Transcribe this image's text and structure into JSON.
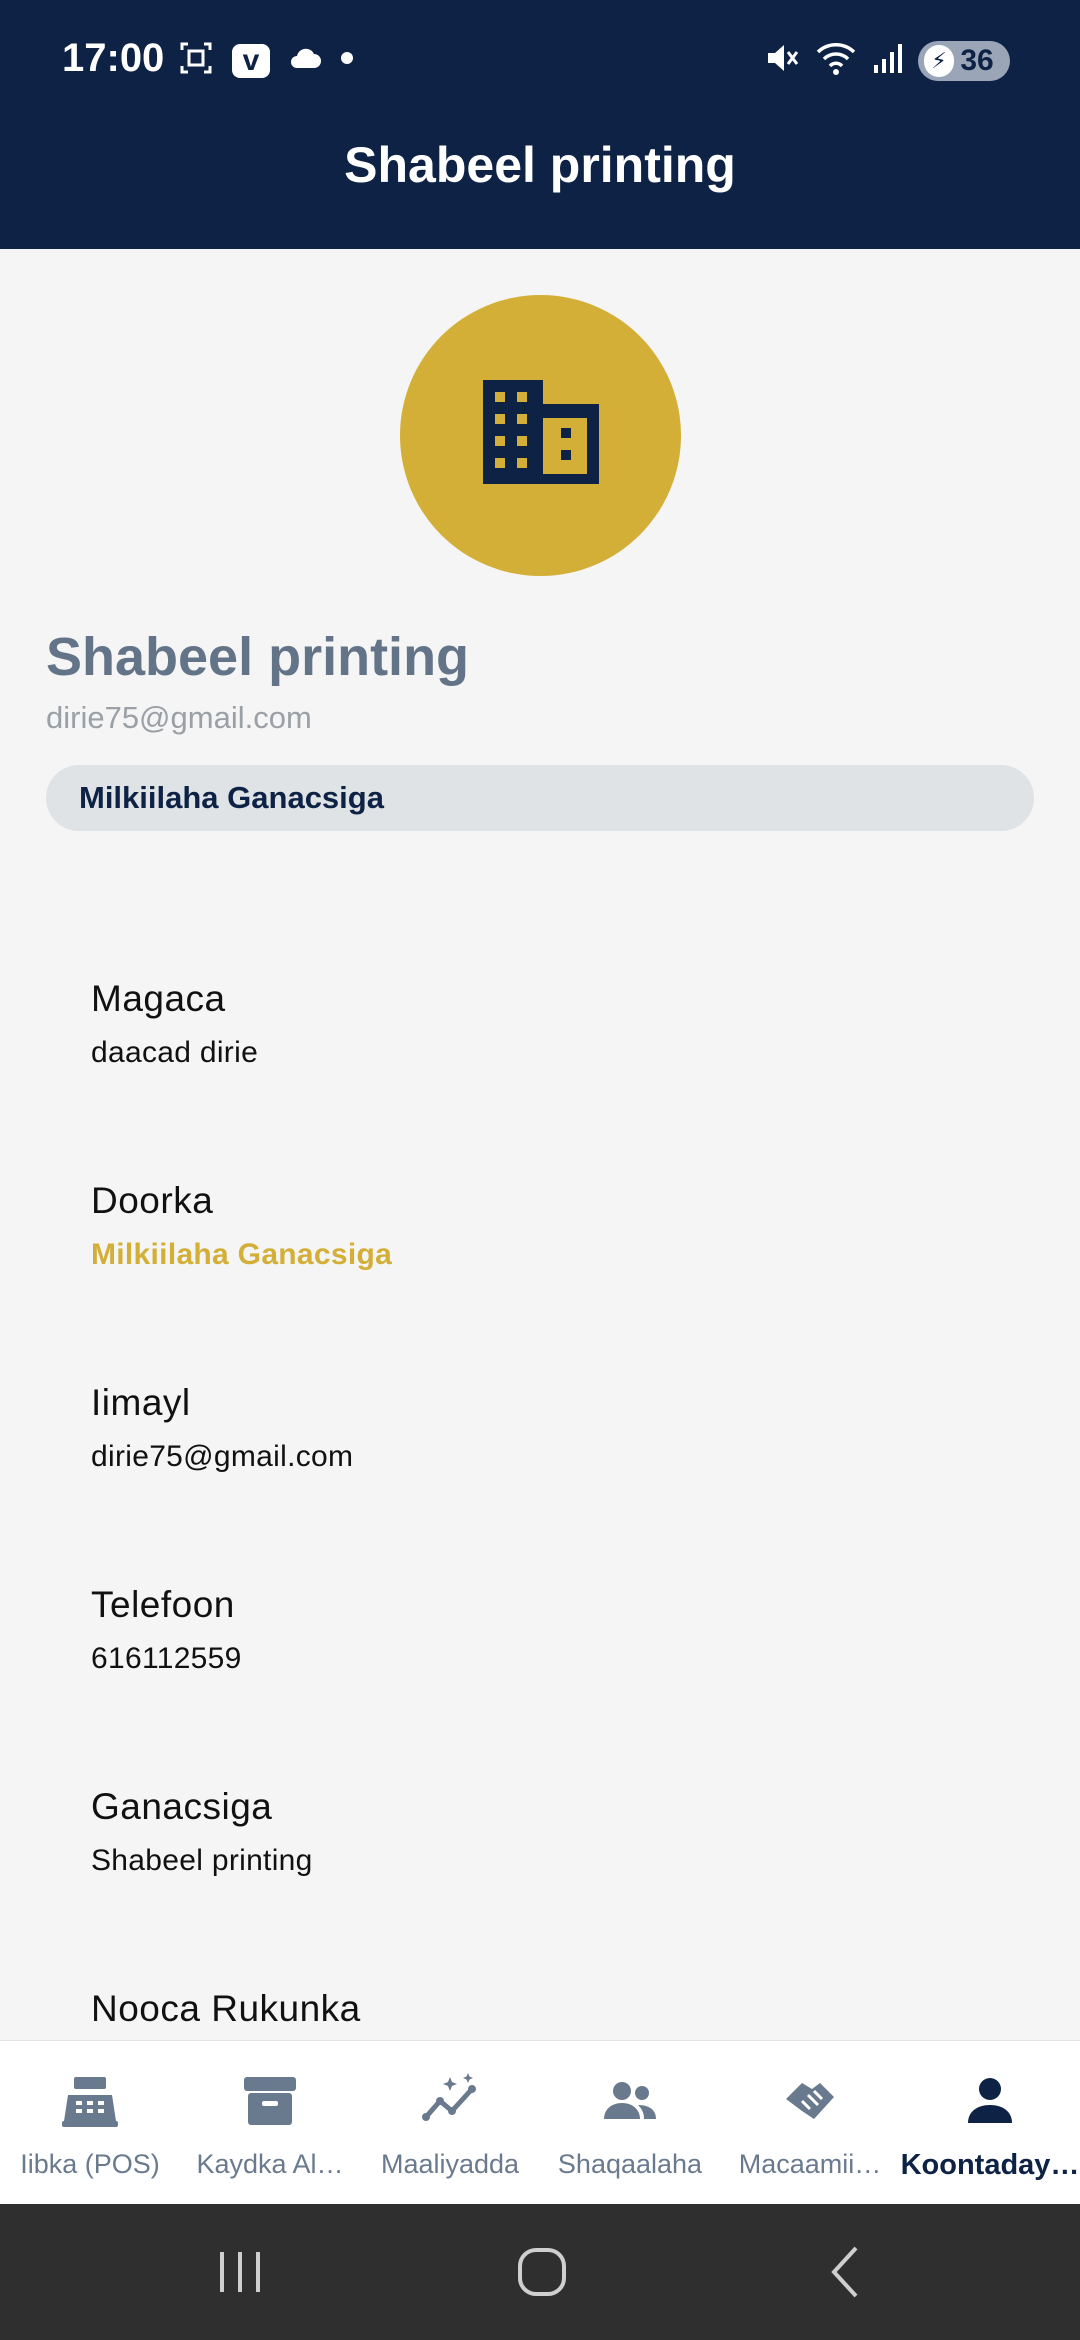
{
  "status_bar": {
    "time": "17:00",
    "battery": "36",
    "icons": [
      "screenshot-icon",
      "v-app-icon",
      "cloud-icon",
      "dot-icon",
      "mute-icon",
      "wifi-icon",
      "signal-icon",
      "battery-charging-icon"
    ]
  },
  "app_bar": {
    "title": "Shabeel printing"
  },
  "profile": {
    "avatar_icon": "building-icon",
    "name": "Shabeel printing",
    "email": "dirie75@gmail.com",
    "role_chip": "Milkiilaha Ganacsiga"
  },
  "fields": [
    {
      "label": "Magaca",
      "value": "daacad dirie"
    },
    {
      "label": "Doorka",
      "value": "Milkiilaha Ganacsiga"
    },
    {
      "label": "Iimayl",
      "value": "dirie75@gmail.com"
    },
    {
      "label": "Telefoon",
      "value": "616112559"
    },
    {
      "label": "Ganacsiga",
      "value": "Shabeel printing"
    },
    {
      "label": "Nooca Rukunka",
      "value": ""
    }
  ],
  "bottom_nav": [
    {
      "label": "Iibka (POS)",
      "icon": "cash-register-icon"
    },
    {
      "label": "Kaydka Al…",
      "icon": "archive-box-icon"
    },
    {
      "label": "Maaliyadda",
      "icon": "analytics-icon"
    },
    {
      "label": "Shaqaalaha",
      "icon": "people-icon"
    },
    {
      "label": "Macaamii…",
      "icon": "handshake-icon"
    },
    {
      "label": "Koontaday…",
      "icon": "person-icon",
      "active": true
    }
  ],
  "colors": {
    "primary": "#0d2244",
    "accent": "#d4af37",
    "muted_title": "#647488",
    "background": "#f4f5f4"
  }
}
